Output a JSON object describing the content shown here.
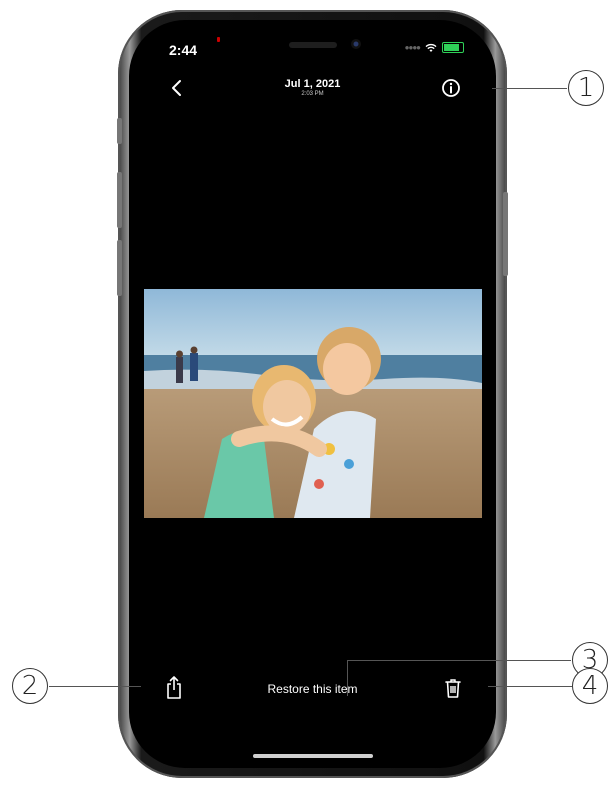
{
  "status_bar": {
    "time": "2:44"
  },
  "header": {
    "date": "Jul 1, 2021",
    "time": "2:03 PM"
  },
  "footer": {
    "restore_label": "Restore this item"
  },
  "callouts": {
    "c1": "1",
    "c2": "2",
    "c3": "3",
    "c4": "4"
  },
  "icons": {
    "back": "chevron-left-icon",
    "info": "info-icon",
    "share": "share-icon",
    "delete": "trash-icon"
  },
  "colors": {
    "screen_bg": "#000000",
    "battery": "#2fd158",
    "text": "#ffffff"
  }
}
